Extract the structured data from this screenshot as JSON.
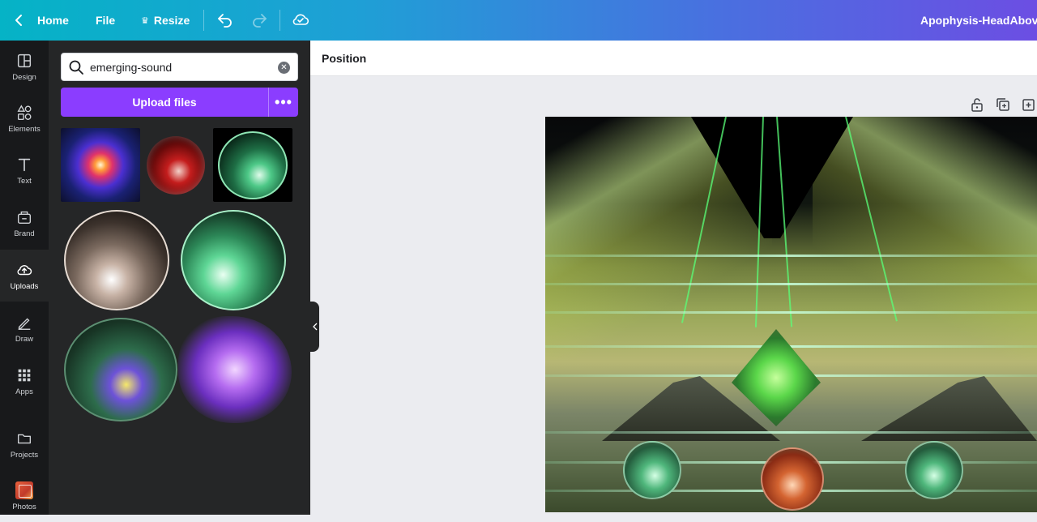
{
  "topbar": {
    "home_label": "Home",
    "file_label": "File",
    "resize_label": "Resize",
    "design_title": "Apophysis-HeadAboveW",
    "gradient_start": "#05b3c6",
    "gradient_end": "#6c4ee3"
  },
  "rail": {
    "items": [
      {
        "label": "Design",
        "icon": "design-icon"
      },
      {
        "label": "Elements",
        "icon": "elements-icon"
      },
      {
        "label": "Text",
        "icon": "text-icon"
      },
      {
        "label": "Brand",
        "icon": "brand-icon"
      },
      {
        "label": "Uploads",
        "icon": "upload-icon",
        "active": true
      },
      {
        "label": "Draw",
        "icon": "draw-icon"
      },
      {
        "label": "Apps",
        "icon": "apps-icon"
      },
      {
        "label": "Projects",
        "icon": "folder-icon"
      },
      {
        "label": "Photos",
        "icon": "photos-icon"
      }
    ]
  },
  "panel": {
    "search_value": "emerging-sound",
    "upload_label": "Upload files",
    "more_label": "•••",
    "accent": "#8b3dff"
  },
  "editor": {
    "position_label": "Position"
  }
}
